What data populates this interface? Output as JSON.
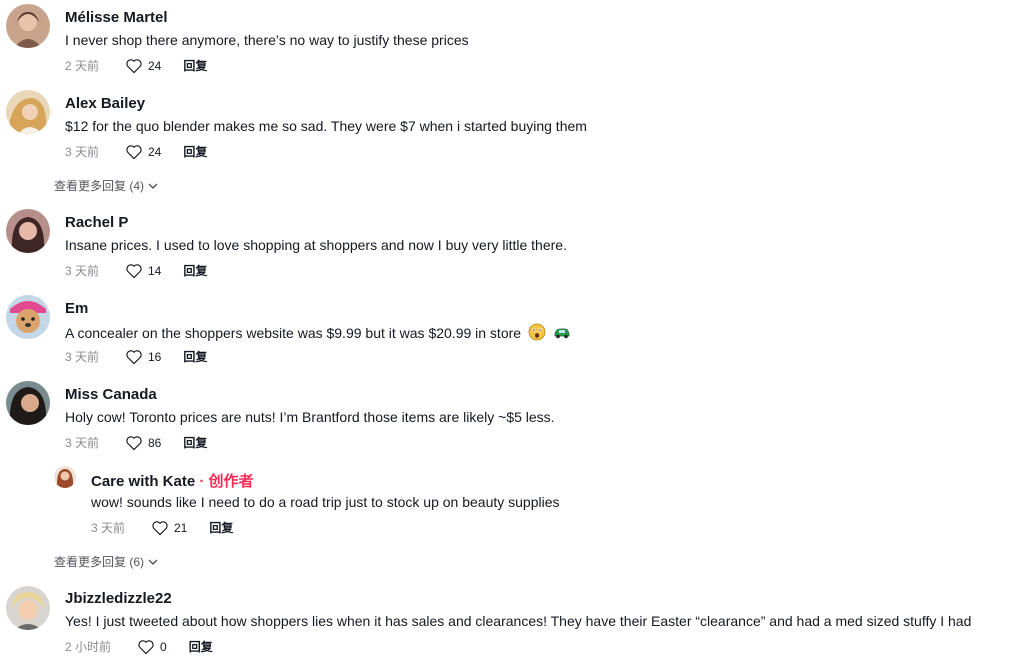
{
  "comments": [
    {
      "name": "Mélisse Martel",
      "text": "I never shop there anymore, there’s no way to justify these prices",
      "time": "2 天前",
      "likes": "24",
      "reply": "回复"
    },
    {
      "name": "Alex Bailey",
      "text": "$12 for the quo blender makes me so sad. They were $7 when i started buying them",
      "time": "3 天前",
      "likes": "24",
      "reply": "回复"
    },
    {
      "name": "Rachel P",
      "text": "Insane prices. I used to love shopping at shoppers and now I buy very little there.",
      "time": "3 天前",
      "likes": "14",
      "reply": "回复"
    },
    {
      "name": "Em",
      "text": "A concealer on the shoppers website was $9.99 but it was $20.99 in store",
      "time": "3 天前",
      "likes": "16",
      "reply": "回复"
    },
    {
      "name": "Miss Canada",
      "text": "Holy cow! Toronto prices are nuts! I’m Brantford those items are likely ~$5 less.",
      "time": "3 天前",
      "likes": "86",
      "reply": "回复"
    },
    {
      "name": "Jbizzledizzle22",
      "text": "Yes! I just tweeted about how shoppers lies when it has sales and clearances! They have their Easter “clearance” and had a med sized stuffy I had",
      "time": "2 小时前",
      "likes": "0",
      "reply": "回复"
    }
  ],
  "creator_reply": {
    "name": "Care with Kate",
    "separator": " · ",
    "badge": "创作者",
    "text": "wow! sounds like I need to do a road trip just to stock up on beauty supplies",
    "time": "3 天前",
    "likes": "21",
    "reply": "回复"
  },
  "view_more": [
    {
      "label": "查看更多回复 (4)"
    },
    {
      "label": "查看更多回复 (6)"
    }
  ],
  "icons": {
    "like": "heart-outline-icon",
    "expand": "chevron-down-icon"
  }
}
